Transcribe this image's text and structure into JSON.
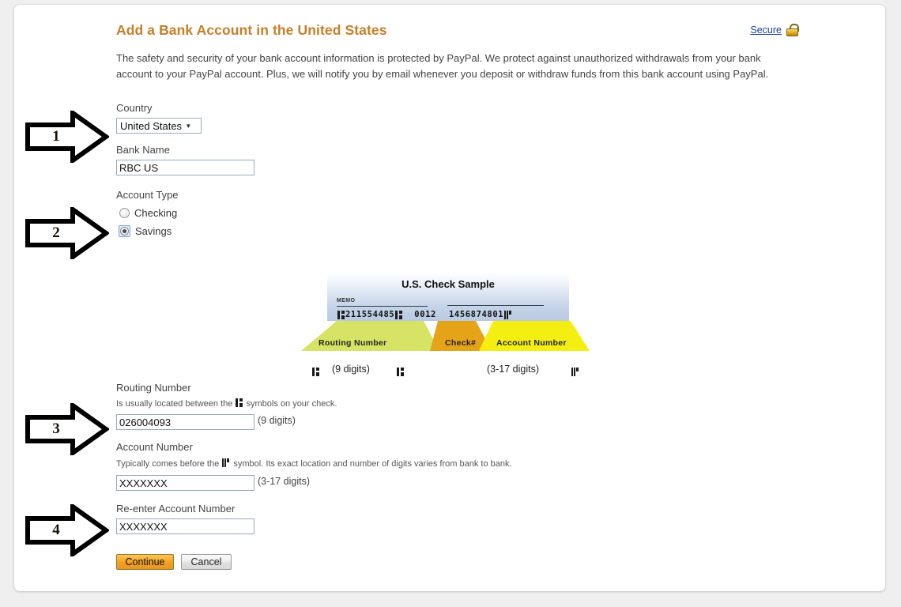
{
  "header": {
    "title": "Add a Bank Account in the United States",
    "secure_label": "Secure",
    "lock_icon": "padlock-icon",
    "accent_color": "#c87d28"
  },
  "intro": {
    "text": "The safety and security of your bank account information is protected by PayPal. We protect against unauthorized withdrawals from your bank account to your PayPal account. Plus, we will notify you by email whenever you deposit or withdraw funds from this bank account using PayPal."
  },
  "form": {
    "country": {
      "label": "Country",
      "value": "United States",
      "caret": "▾"
    },
    "bank_name": {
      "label": "Bank Name",
      "value": "RBC US"
    },
    "account_type": {
      "label": "Account Type",
      "options": [
        {
          "label": "Checking",
          "selected": false
        },
        {
          "label": "Savings",
          "selected": true
        }
      ]
    },
    "routing_number": {
      "label": "Routing Number",
      "hint_before": "Is usually located between the",
      "hint_after": "symbols on your check.",
      "value": "026004093",
      "suffix": "(9 digits)"
    },
    "account_number": {
      "label": "Account Number",
      "hint_before": "Typically comes before the",
      "hint_after": "symbol. Its exact location and number of digits varies from bank to bank.",
      "value": "XXXXXXX",
      "suffix": "(3-17 digits)"
    },
    "reenter_account_number": {
      "label": "Re-enter Account Number",
      "value": "XXXXXXX"
    },
    "buttons": {
      "continue": "Continue",
      "cancel": "Cancel"
    }
  },
  "check_sample": {
    "title": "U.S. Check Sample",
    "memo_word": "MEMO",
    "micr": {
      "routing": "211554485",
      "check_no": "0012",
      "account": "1456874801"
    },
    "zones": [
      {
        "label": "Routing Number",
        "color": "#d4e157",
        "note": "(9 digits)"
      },
      {
        "label": "Check#",
        "color": "#e8a317",
        "note": ""
      },
      {
        "label": "Account Number",
        "color": "#f2ee0a",
        "note": "(3-17 digits)"
      }
    ]
  },
  "annotations": {
    "arrows": [
      {
        "number": "1"
      },
      {
        "number": "2"
      },
      {
        "number": "3"
      },
      {
        "number": "4"
      }
    ]
  }
}
